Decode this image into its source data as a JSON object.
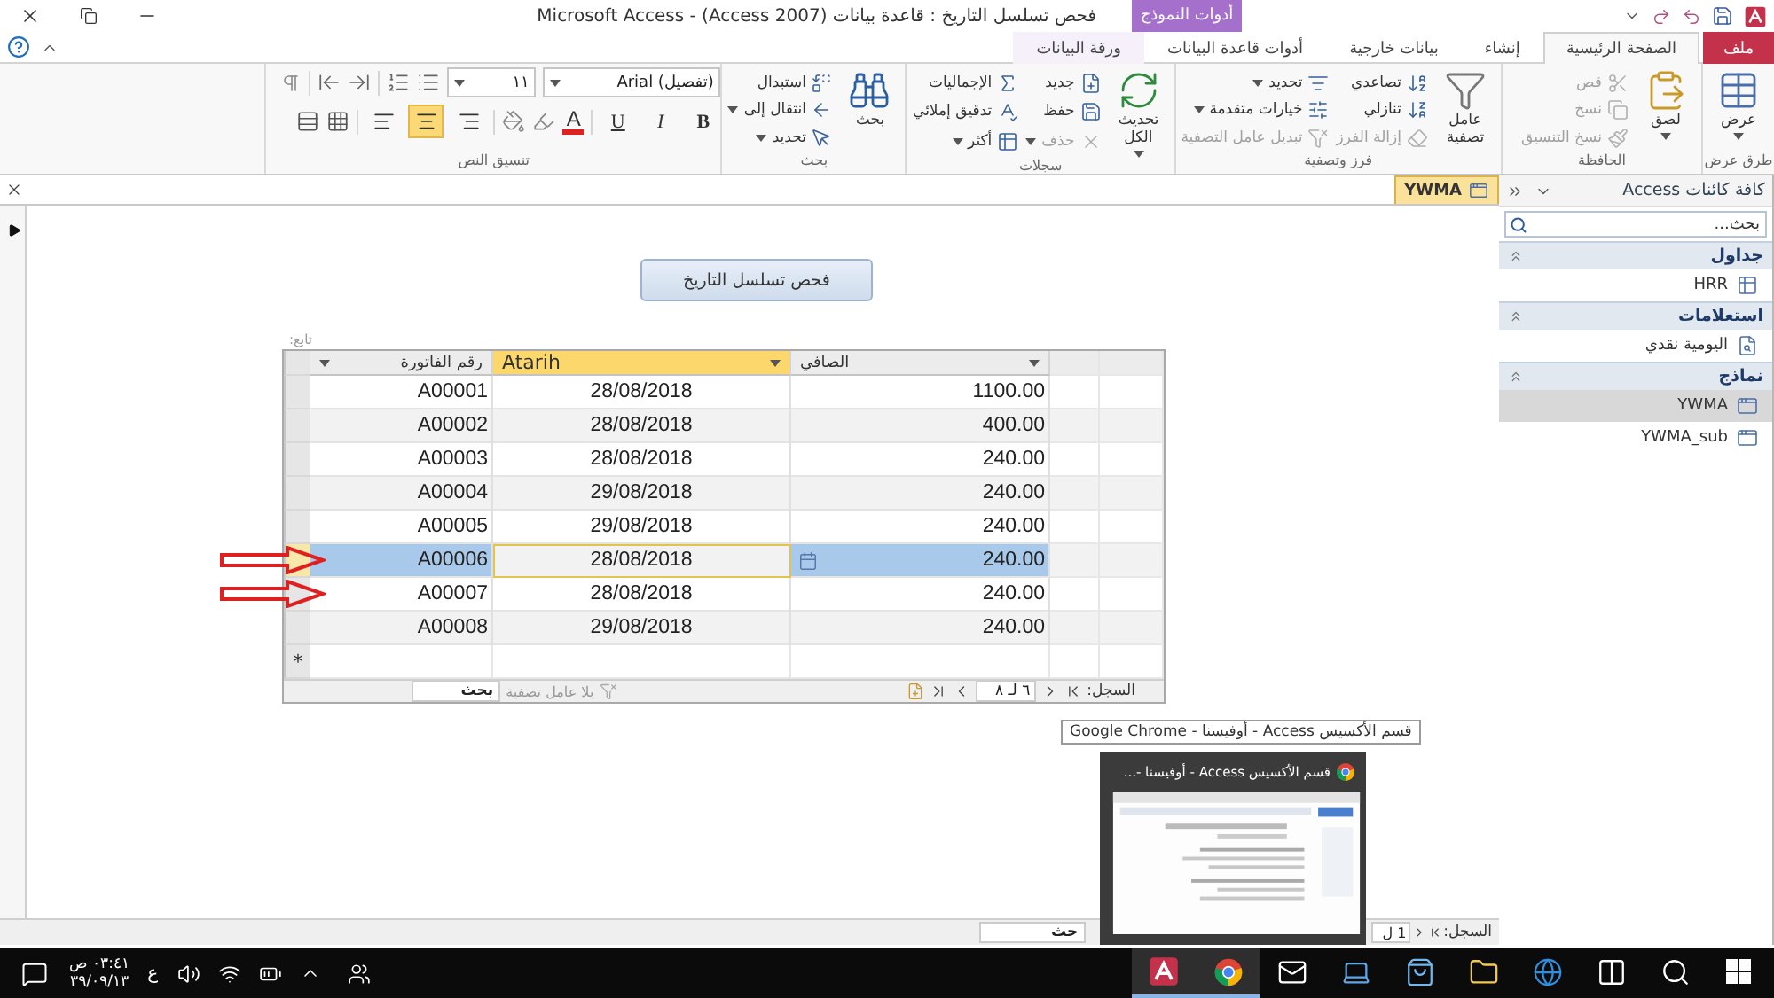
{
  "window": {
    "title": "فحص تسلسل التاريخ : قاعدة بيانات (Access 2007) - Microsoft Access",
    "context_tab": "أدوات النموذج"
  },
  "tabs": [
    {
      "label": "ملف",
      "kind": "file",
      "selected": false
    },
    {
      "label": "الصفحة الرئيسية",
      "kind": "tab",
      "selected": true
    },
    {
      "label": "إنشاء",
      "kind": "tab",
      "selected": false
    },
    {
      "label": "بيانات خارجية",
      "kind": "tab",
      "selected": false
    },
    {
      "label": "أدوات قاعدة البيانات",
      "kind": "tab",
      "selected": false
    },
    {
      "label": "ورقة البيانات",
      "kind": "context",
      "selected": false
    }
  ],
  "ribbon": {
    "groups": [
      {
        "kind": "buttons",
        "title": "طرق عرض",
        "large": [
          {
            "label": "عرض",
            "dropdown": true
          }
        ]
      },
      {
        "kind": "buttons",
        "title": "الحافظة",
        "large": [
          {
            "label": "لصق",
            "dropdown": true
          }
        ],
        "small": [
          [
            {
              "label": "قص",
              "disabled": true,
              "dropdown": false
            },
            {
              "label": "نسخ",
              "disabled": true,
              "dropdown": false
            },
            {
              "label": "نسخ التنسيق",
              "disabled": true,
              "dropdown": false
            }
          ]
        ]
      },
      {
        "kind": "buttons",
        "title": "فرز وتصفية",
        "large": [
          {
            "label": "عامل تصفية",
            "dropdown": false
          }
        ],
        "small": [
          [
            {
              "label": "تصاعدي",
              "disabled": false,
              "dropdown": false
            },
            {
              "label": "تنازلي",
              "disabled": false,
              "dropdown": false
            },
            {
              "label": "إزالة الفرز",
              "disabled": true,
              "dropdown": false
            }
          ],
          [
            {
              "label": "تحديد",
              "disabled": false,
              "dropdown": true
            },
            {
              "label": "خيارات متقدمة",
              "disabled": false,
              "dropdown": true
            },
            {
              "label": "تبديل عامل التصفية",
              "disabled": true,
              "dropdown": false
            }
          ]
        ]
      },
      {
        "kind": "buttons",
        "title": "سجلات",
        "large": [
          {
            "label": "تحديث الكل",
            "dropdown": true
          }
        ],
        "small": [
          [
            {
              "label": "جديد",
              "disabled": false,
              "dropdown": false
            },
            {
              "label": "حفظ",
              "disabled": false,
              "dropdown": false
            },
            {
              "label": "حذف",
              "disabled": true,
              "dropdown": true
            }
          ],
          [
            {
              "label": "الإجماليات",
              "disabled": false,
              "dropdown": false
            },
            {
              "label": "تدقيق إملائي",
              "disabled": false,
              "dropdown": false
            },
            {
              "label": "أكثر",
              "disabled": false,
              "dropdown": true
            }
          ]
        ]
      },
      {
        "kind": "buttons",
        "title": "بحث",
        "large": [
          {
            "label": "بحث",
            "dropdown": false
          }
        ],
        "small": [
          [
            {
              "label": "استبدال",
              "disabled": false,
              "dropdown": false
            },
            {
              "label": "انتقال إلى",
              "disabled": false,
              "dropdown": true
            },
            {
              "label": "تحديد",
              "disabled": false,
              "dropdown": true
            }
          ]
        ]
      },
      {
        "kind": "text_format",
        "title": "تنسيق النص",
        "font": "Arial (تفصيل)",
        "size": "١١",
        "styles": [
          {
            "label": "B",
            "kind": "bold"
          },
          {
            "label": "I",
            "kind": "italic"
          },
          {
            "label": "U",
            "kind": "underline"
          }
        ],
        "font_color": "A",
        "align": [
          {
            "kind": "right",
            "selected": false
          },
          {
            "kind": "center",
            "selected": true
          },
          {
            "kind": "left",
            "selected": false
          }
        ]
      }
    ]
  },
  "document": {
    "tab": {
      "label": "YWMA",
      "selected": true
    },
    "form": {
      "button": "فحص تسلسل التاريخ",
      "subform": {
        "label": "تابع:",
        "columns": [
          {
            "label": "الصافي",
            "selected": false
          },
          {
            "label": "Atarih",
            "selected": true
          },
          {
            "label": "رقم الفاتورة",
            "selected": false
          }
        ],
        "rows": [
          {
            "cells": [
              "1100.00",
              "28/08/2018",
              "A00001"
            ],
            "selected": false,
            "marked": false
          },
          {
            "cells": [
              "400.00",
              "28/08/2018",
              "A00002"
            ],
            "selected": false,
            "marked": false
          },
          {
            "cells": [
              "240.00",
              "28/08/2018",
              "A00003"
            ],
            "selected": false,
            "marked": false
          },
          {
            "cells": [
              "240.00",
              "29/08/2018",
              "A00004"
            ],
            "selected": false,
            "marked": false
          },
          {
            "cells": [
              "240.00",
              "29/08/2018",
              "A00005"
            ],
            "selected": false,
            "marked": false
          },
          {
            "cells": [
              "240.00",
              "28/08/2018",
              "A00006"
            ],
            "selected": true,
            "marked": true
          },
          {
            "cells": [
              "240.00",
              "28/08/2018",
              "A00007"
            ],
            "selected": false,
            "marked": true
          },
          {
            "cells": [
              "240.00",
              "29/08/2018",
              "A00008"
            ],
            "selected": false,
            "marked": false
          }
        ],
        "new_row": "*",
        "navigation": {
          "label": "السجل:",
          "position": "٦ لـ ٨",
          "filter": "بلا عامل تصفية",
          "search_placeholder": "بحث"
        }
      }
    },
    "navigation": {
      "label": "السجل:",
      "position": "1 ل",
      "search_placeholder": "حث"
    }
  },
  "nav_pane": {
    "title": "كافة كائنات Access",
    "search_placeholder": "بحث...",
    "sections": [
      {
        "title": "جداول",
        "kind": "table",
        "expanded": true,
        "items": [
          {
            "label": "HRR",
            "selected": false
          }
        ]
      },
      {
        "title": "استعلامات",
        "kind": "query",
        "expanded": true,
        "items": [
          {
            "label": "اليومية نقدي",
            "selected": false
          }
        ]
      },
      {
        "title": "نماذج",
        "kind": "form",
        "expanded": true,
        "items": [
          {
            "label": "YWMA",
            "selected": true
          },
          {
            "label": "YWMA_sub",
            "selected": false
          }
        ]
      }
    ]
  },
  "tooltip": "قسم الأكسيس Access - أوفيسنا - Google Chrome",
  "thumbnail": {
    "title": "قسم الأكسيس Access - أوفيسنا -..."
  },
  "taskbar": {
    "time": "٠٣:٤١ ص",
    "date": "٣٩/٠٩/١٣",
    "language": "ع",
    "apps": [
      {
        "kind": "database",
        "active": true
      },
      {
        "kind": "browser",
        "active": true
      },
      {
        "kind": "mail",
        "active": false
      },
      {
        "kind": "laptop",
        "active": false
      },
      {
        "kind": "store",
        "active": false
      },
      {
        "kind": "folder",
        "active": false
      },
      {
        "kind": "globe",
        "active": false
      },
      {
        "kind": "task_view",
        "active": false
      },
      {
        "kind": "search",
        "active": false
      },
      {
        "kind": "start",
        "active": false
      }
    ]
  }
}
